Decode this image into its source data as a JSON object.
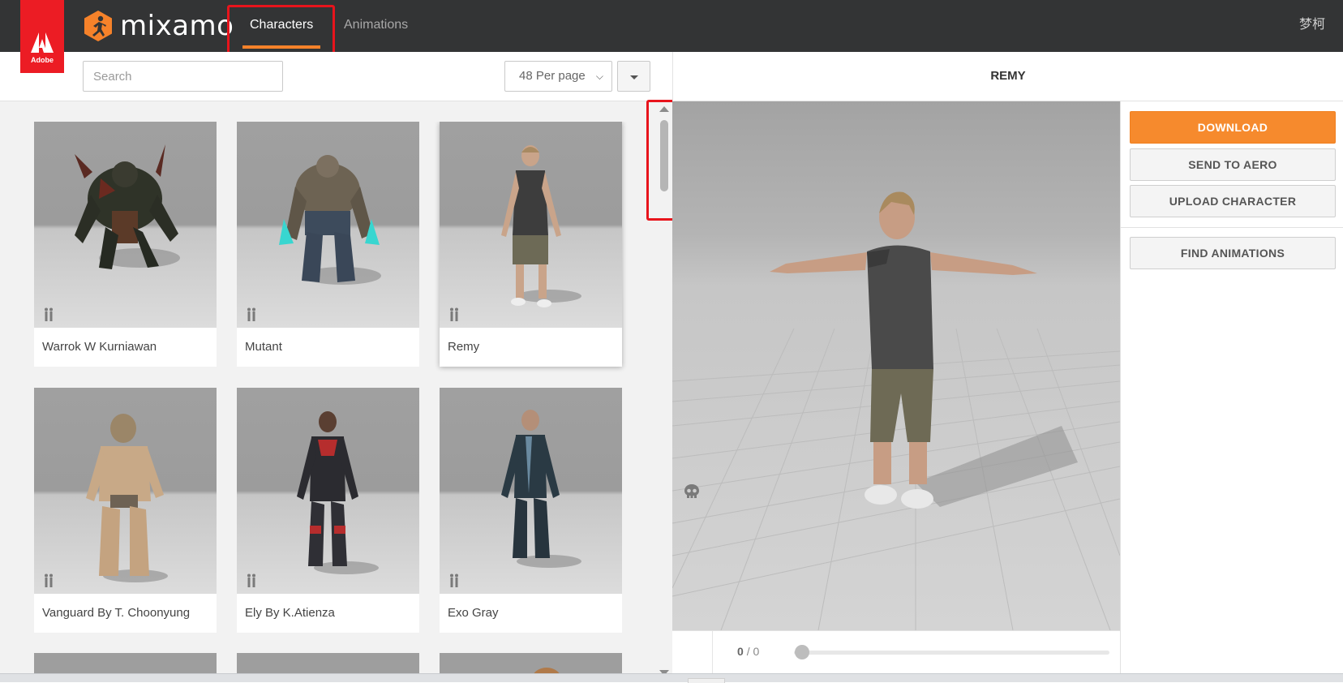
{
  "header": {
    "adobe_label": "Adobe",
    "brand": "mixamo",
    "tabs": [
      {
        "label": "Characters",
        "active": true
      },
      {
        "label": "Animations",
        "active": false
      }
    ],
    "user": "梦柯"
  },
  "toolbar": {
    "search_placeholder": "Search",
    "per_page": "48 Per page"
  },
  "characters": [
    {
      "name": "Warrok W Kurniawan",
      "selected": false
    },
    {
      "name": "Mutant",
      "selected": false
    },
    {
      "name": "Remy",
      "selected": true
    },
    {
      "name": "Vanguard By T. Choonyung",
      "selected": false
    },
    {
      "name": "Ely By K.Atienza",
      "selected": false
    },
    {
      "name": "Exo Gray",
      "selected": false
    }
  ],
  "viewer": {
    "title": "REMY",
    "frame_current": "0",
    "frame_total": "/ 0",
    "progress": 0
  },
  "actions": {
    "download": "DOWNLOAD",
    "send_to_aero": "SEND TO AERO",
    "upload_character": "UPLOAD CHARACTER",
    "find_animations": "FIND ANIMATIONS"
  },
  "colors": {
    "accent": "#f6822a",
    "topbar": "#333435",
    "adobe_red": "#ec1c24",
    "highlight_box": "#e8141c"
  }
}
